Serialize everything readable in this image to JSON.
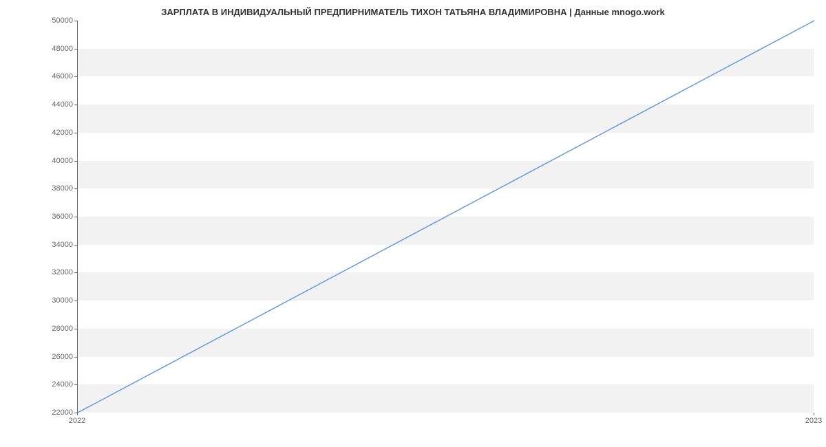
{
  "chart_data": {
    "type": "line",
    "title": "ЗАРПЛАТА В ИНДИВИДУАЛЬНЫЙ ПРЕДПИРНИМАТЕЛЬ ТИХОН ТАТЬЯНА ВЛАДИМИРОВНА | Данные mnogo.work",
    "xlabel": "",
    "ylabel": "",
    "x": [
      2022,
      2023
    ],
    "values": [
      22000,
      50000
    ],
    "x_ticks": [
      2022,
      2023
    ],
    "y_ticks": [
      22000,
      24000,
      26000,
      28000,
      30000,
      32000,
      34000,
      36000,
      38000,
      40000,
      42000,
      44000,
      46000,
      48000,
      50000
    ],
    "ylim": [
      22000,
      50000
    ],
    "xlim": [
      2022,
      2023
    ],
    "line_color": "#6699dd",
    "grid": "horizontal-bands"
  }
}
